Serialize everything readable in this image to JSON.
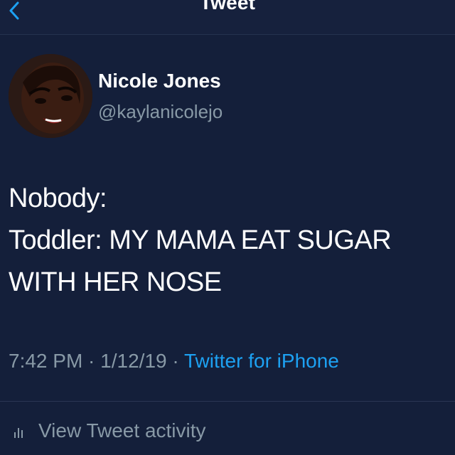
{
  "header": {
    "title": "Tweet",
    "back_icon": "chevron-left-icon"
  },
  "author": {
    "name": "Nicole Jones",
    "handle": "@kaylanicolejo",
    "avatar_icon": "avatar"
  },
  "tweet": {
    "lines": [
      "Nobody:",
      "Toddler: MY MAMA EAT SUGAR",
      "WITH HER NOSE"
    ]
  },
  "meta": {
    "time": "7:42 PM",
    "separator": " · ",
    "date": "1/12/19",
    "source": "Twitter for iPhone"
  },
  "activity": {
    "label": "View Tweet activity",
    "icon": "bar-chart-icon"
  },
  "colors": {
    "background": "#141f3a",
    "secondary_text": "#8899a6",
    "link": "#1da1f2"
  }
}
